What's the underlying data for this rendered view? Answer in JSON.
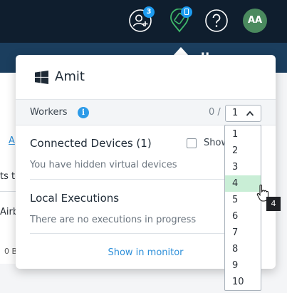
{
  "topbar": {
    "contacts_badge": "3",
    "subbar_text": "u",
    "avatar_initials": "AA"
  },
  "background": {
    "fragment_a": "A",
    "fragment_ts": "ts t",
    "fragment_airb": "Airb",
    "fragment_0b": "0 B"
  },
  "popover": {
    "title": "Amit",
    "workers_label": "Workers",
    "info_glyph": "i",
    "workers_count": "0 /",
    "workers_selected": "1",
    "connected_title": "Connected Devices (1)",
    "show_checkbox_label": "Show",
    "hidden_devices_text": "You have hidden virtual devices",
    "local_title": "Local Executions",
    "no_executions_text": "There are no executions in progress",
    "monitor_link": "Show in monitor"
  },
  "dropdown": {
    "options": [
      "1",
      "2",
      "3",
      "4",
      "5",
      "6",
      "7",
      "8",
      "9",
      "10"
    ],
    "hovered": "4"
  },
  "tooltip": {
    "text": "4"
  },
  "colors": {
    "topbar": "#0f1e2e",
    "subbar": "#1b3e5e",
    "accent": "#2d9be8",
    "selected_option": "#c9eed6",
    "device_icon": "#3fb86b",
    "avatar": "#4a8a5e"
  },
  "icons": {
    "contacts": "add-user-icon",
    "device": "device-location-icon",
    "help": "help-icon",
    "windows": "windows-icon",
    "info": "info-icon",
    "select_chevron": "chevron-up-icon",
    "cursor": "hand-cursor-icon"
  }
}
